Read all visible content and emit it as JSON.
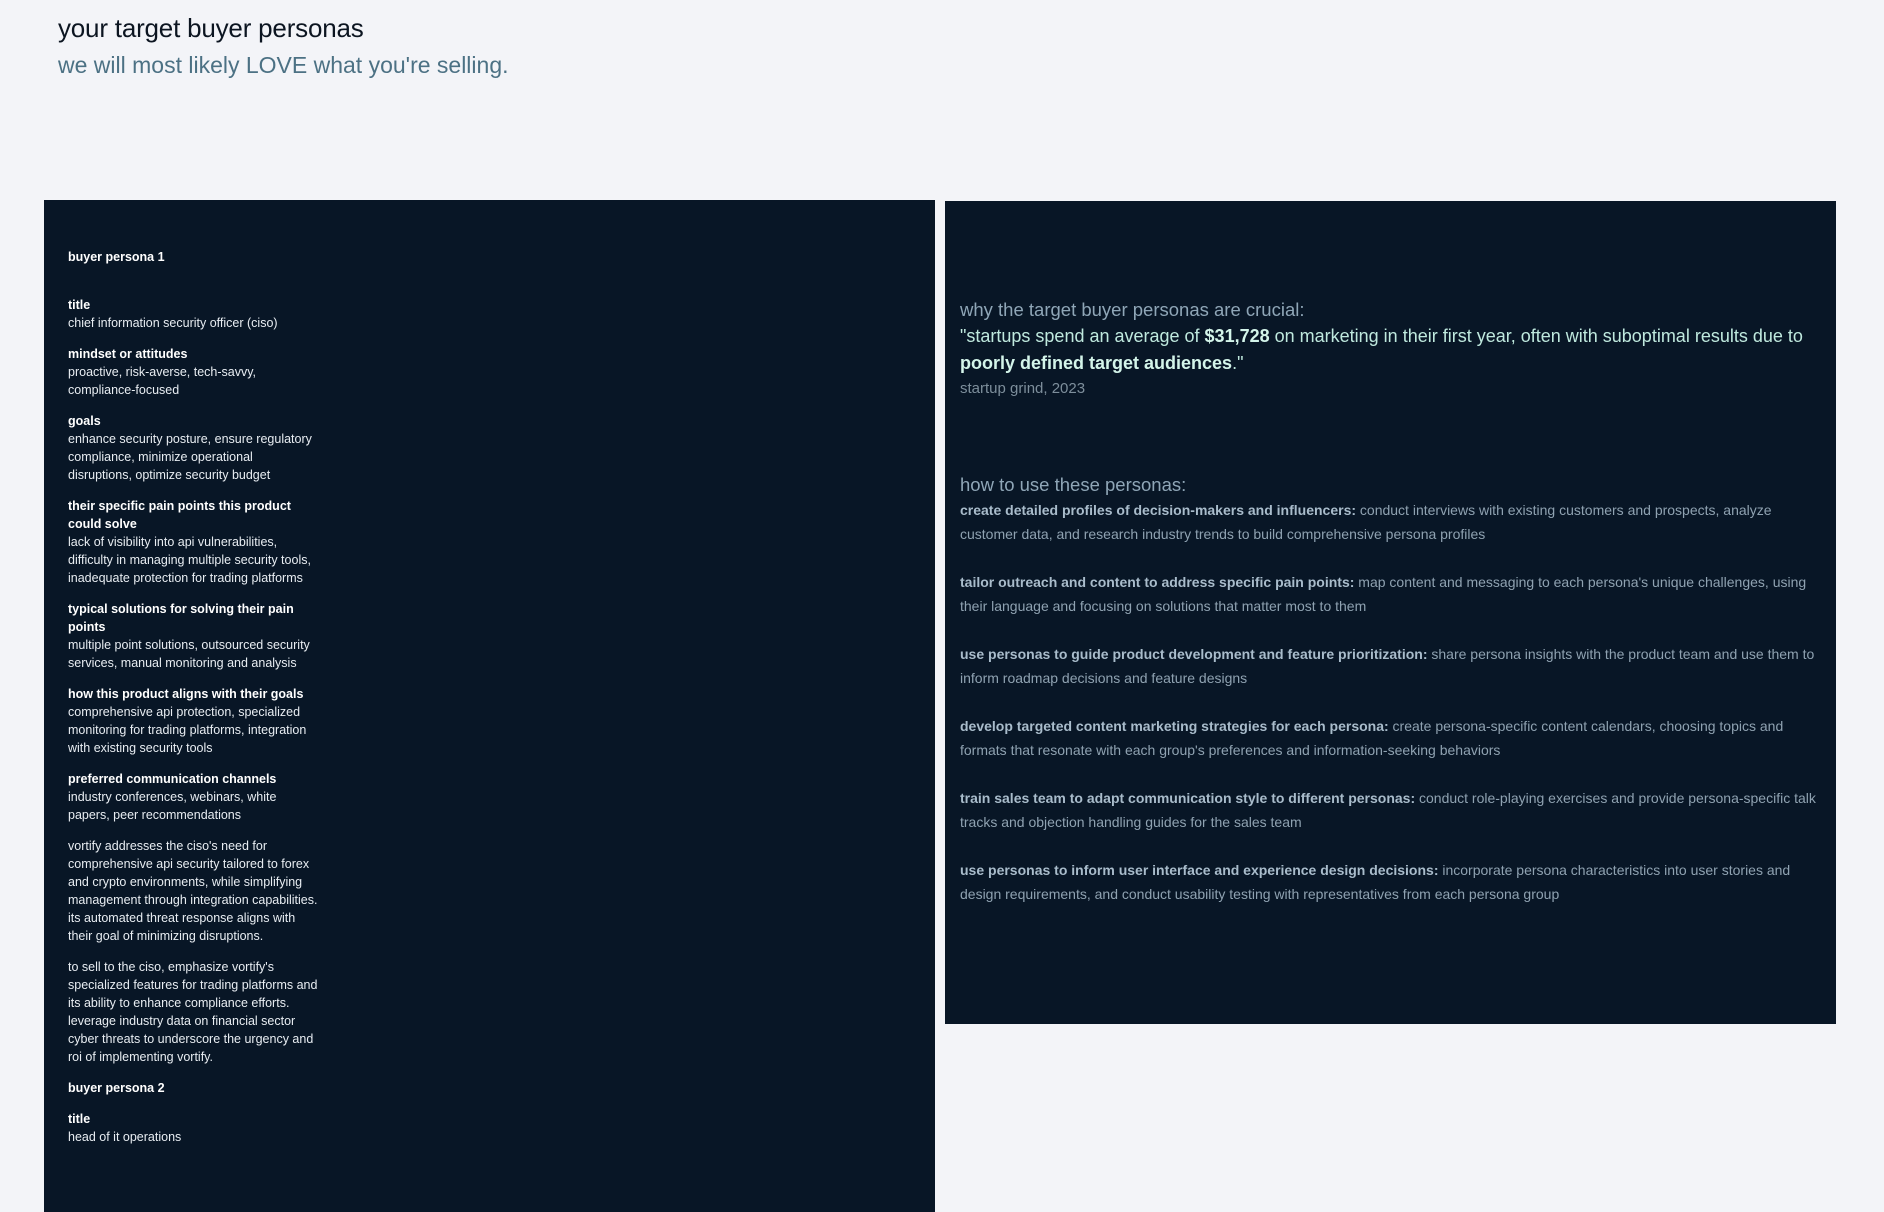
{
  "header": {
    "title": "your target buyer personas",
    "subtitle": "we will most likely LOVE what you're selling."
  },
  "personas_panel": {
    "persona1": {
      "heading": "buyer persona 1",
      "fields": [
        {
          "label": "title",
          "value": "chief information security officer (ciso)"
        },
        {
          "label": "mindset or attitudes",
          "value": "proactive, risk-averse, tech-savvy, compliance-focused"
        },
        {
          "label": "goals",
          "value": "enhance security posture, ensure regulatory compliance, minimize operational disruptions, optimize security budget"
        },
        {
          "label": "their specific pain points this product could solve",
          "value": "lack of visibility into api vulnerabilities, difficulty in managing multiple security tools, inadequate protection for trading platforms"
        },
        {
          "label": "typical solutions for solving their pain points",
          "value": "multiple point solutions, outsourced security services, manual monitoring and analysis"
        },
        {
          "label": "how this product aligns with their goals",
          "value": "comprehensive api protection, specialized monitoring for trading platforms, integration with existing security tools"
        },
        {
          "label": "preferred communication channels",
          "value": "industry conferences, webinars, white papers, peer recommendations"
        }
      ],
      "paragraphs": [
        "vortify addresses the ciso's need for comprehensive api security tailored to forex and crypto environments, while simplifying management through integration capabilities. its automated threat response aligns with their goal of minimizing disruptions.",
        "to sell to the ciso, emphasize vortify's specialized features for trading platforms and its ability to enhance compliance efforts. leverage industry data on financial sector cyber threats to underscore the urgency and roi of implementing vortify."
      ]
    },
    "persona2": {
      "heading": "buyer persona 2",
      "fields": [
        {
          "label": "title",
          "value": "head of it operations"
        }
      ]
    }
  },
  "insights_panel": {
    "why_heading": "why the target buyer personas are crucial:",
    "quote": {
      "part1": "\"startups spend an average of ",
      "amount": "$31,728",
      "part2": " on marketing in their first year, often with suboptimal results due to ",
      "emphasis": "poorly defined target audiences",
      "part3": ".\""
    },
    "source": "startup grind, 2023",
    "how_heading": "how to use these personas:",
    "items": [
      {
        "lead": "create detailed profiles of decision-makers and influencers:",
        "text": " conduct interviews with existing customers and prospects, analyze customer data, and research industry trends to build comprehensive persona profiles"
      },
      {
        "lead": "tailor outreach and content to address specific pain points:",
        "text": " map content and messaging to each persona's unique challenges, using their language and focusing on solutions that matter most to them"
      },
      {
        "lead": "use personas to guide product development and feature prioritization:",
        "text": " share persona insights with the product team and use them to inform roadmap decisions and feature designs"
      },
      {
        "lead": "develop targeted content marketing strategies for each persona:",
        "text": " create persona-specific content calendars, choosing topics and formats that resonate with each group's preferences and information-seeking behaviors"
      },
      {
        "lead": "train sales team to adapt communication style to different personas:",
        "text": " conduct role-playing exercises and provide persona-specific talk tracks and objection handling guides for the sales team"
      },
      {
        "lead": "use personas to inform user interface and experience design decisions:",
        "text": " incorporate persona characteristics into user stories and design requirements, and conduct usability testing with representatives from each persona group"
      }
    ]
  }
}
